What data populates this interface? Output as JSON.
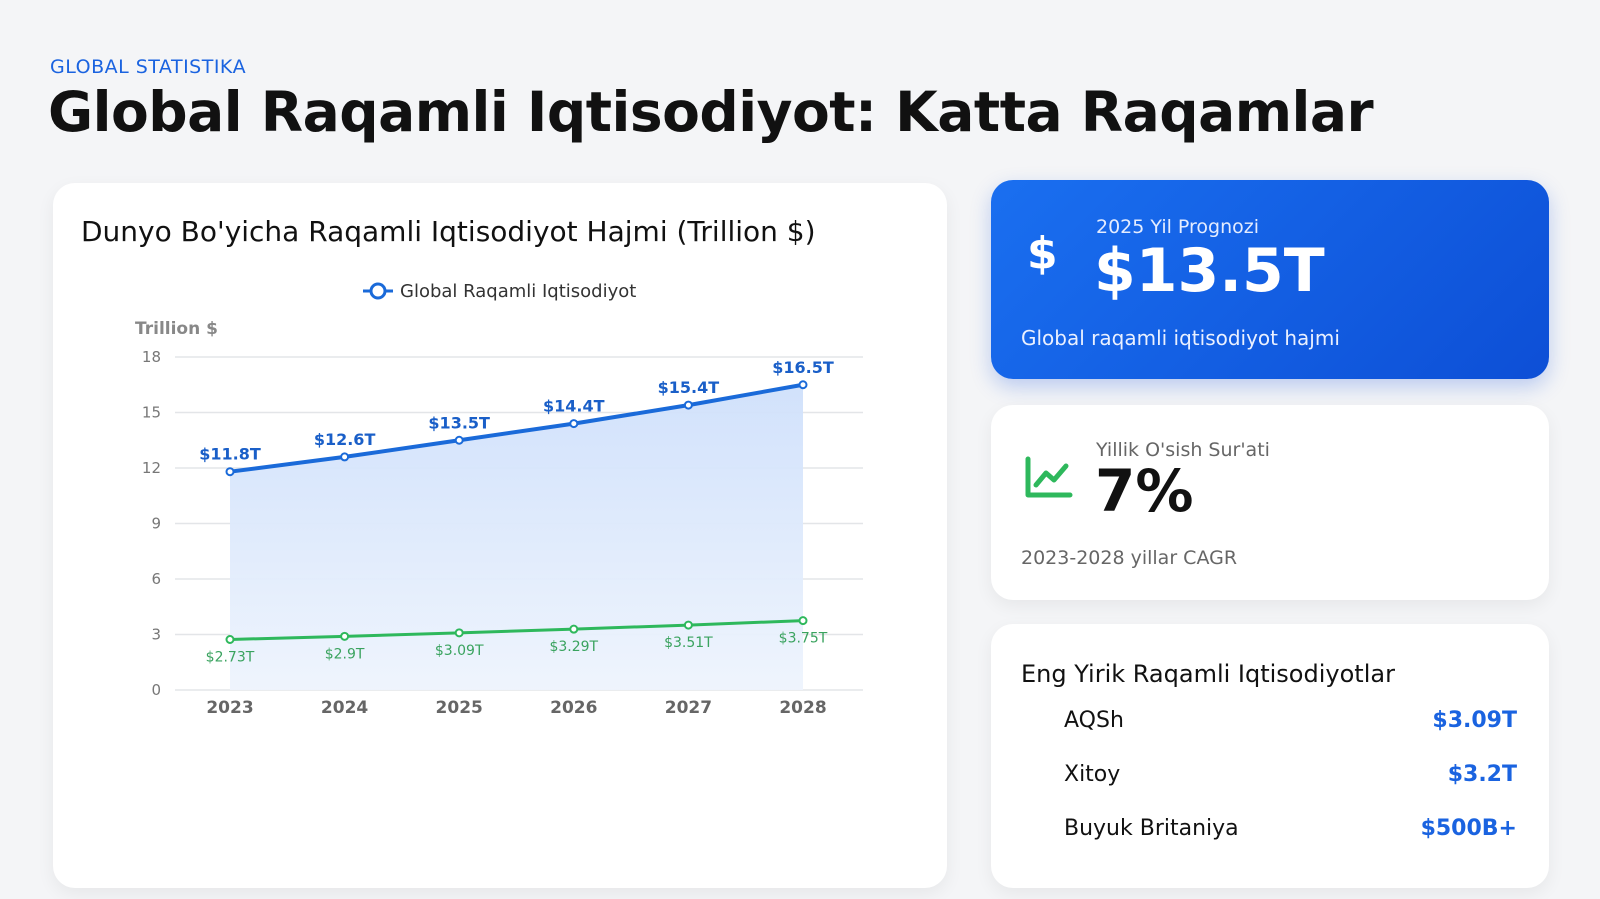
{
  "header": {
    "eyebrow": "GLOBAL STATISTIKA",
    "title": "Global Raqamli Iqtisodiyot: Katta Raqamlar"
  },
  "chart_data": {
    "type": "line",
    "title": "Dunyo Bo'yicha Raqamli Iqtisodiyot Hajmi (Trillion $)",
    "ylabel": "Trillion $",
    "xlabel": "",
    "x": [
      "2023",
      "2024",
      "2025",
      "2026",
      "2027",
      "2028"
    ],
    "ylim": [
      0,
      18
    ],
    "yticks": [
      0,
      3,
      6,
      9,
      12,
      15,
      18
    ],
    "grid": true,
    "legend_position": "top-center",
    "series": [
      {
        "name": "Global Raqamli Iqtisodiyot",
        "values": [
          11.8,
          12.6,
          13.5,
          14.4,
          15.4,
          16.5
        ],
        "labels": [
          "$11.8T",
          "$12.6T",
          "$13.5T",
          "$14.4T",
          "$15.4T",
          "$16.5T"
        ],
        "color": "#1a6ad9",
        "area": true
      },
      {
        "values": [
          2.73,
          2.9,
          3.09,
          3.29,
          3.51,
          3.75
        ],
        "labels": [
          "$2.73T",
          "$2.9T",
          "$3.09T",
          "$3.29T",
          "$3.51T",
          "$3.75T"
        ],
        "color": "#2eb85c",
        "area": false
      }
    ]
  },
  "cards": {
    "forecast": {
      "icon": "dollar-icon",
      "icon_glyph": "$",
      "label": "2025 Yil Prognozi",
      "value": "$13.5T",
      "subtitle": "Global raqamli iqtisodiyot hajmi",
      "color": "#1a6ff0"
    },
    "growth": {
      "icon": "trend-up-icon",
      "label": "Yillik O'sish Sur'ati",
      "value": "7%",
      "subtitle": "2023-2028 yillar CAGR",
      "icon_color": "#2eb85c"
    },
    "economies": {
      "title": "Eng Yirik Raqamli Iqtisodiyotlar",
      "items": [
        {
          "name": "AQSh",
          "value": "$3.09T"
        },
        {
          "name": "Xitoy",
          "value": "$3.2T"
        },
        {
          "name": "Buyuk Britaniya",
          "value": "$500B+"
        }
      ]
    }
  }
}
